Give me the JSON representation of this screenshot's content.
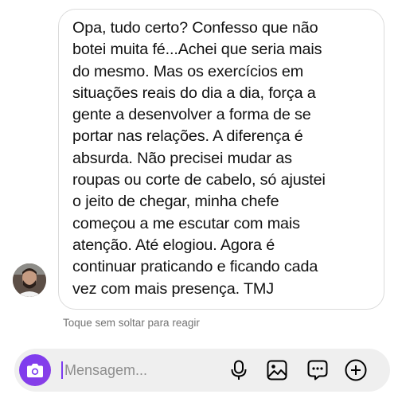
{
  "thread": {
    "message_text": "Opa, tudo certo? Confesso que não\nbotei muita fé...Achei que seria mais\ndo mesmo. Mas os exercícios em\nsituações reais do dia a dia, força a\ngente a desenvolver a forma de se\nportar nas relações. A diferença é\nabsurda. Não precisei mudar as\nroupas ou corte de cabelo, só ajustei\no jeito de chegar, minha chefe\ncomeçou a me escutar com  mais\natenção. Até elogiou. Agora é\ncontinuar praticando e ficando cada\nvez com mais presença. TMJ",
    "hint": "Toque sem soltar para reagir"
  },
  "composer": {
    "placeholder": "Mensagem...",
    "camera_icon": "camera-icon",
    "mic_icon": "microphone-icon",
    "gallery_icon": "image-icon",
    "sticker_icon": "sticker-chat-icon",
    "add_icon": "plus-circle-icon"
  },
  "colors": {
    "accent": "#7b3bf0",
    "composer_bg": "#efefef",
    "bubble_border": "#dbdbdb",
    "hint": "#737373"
  }
}
